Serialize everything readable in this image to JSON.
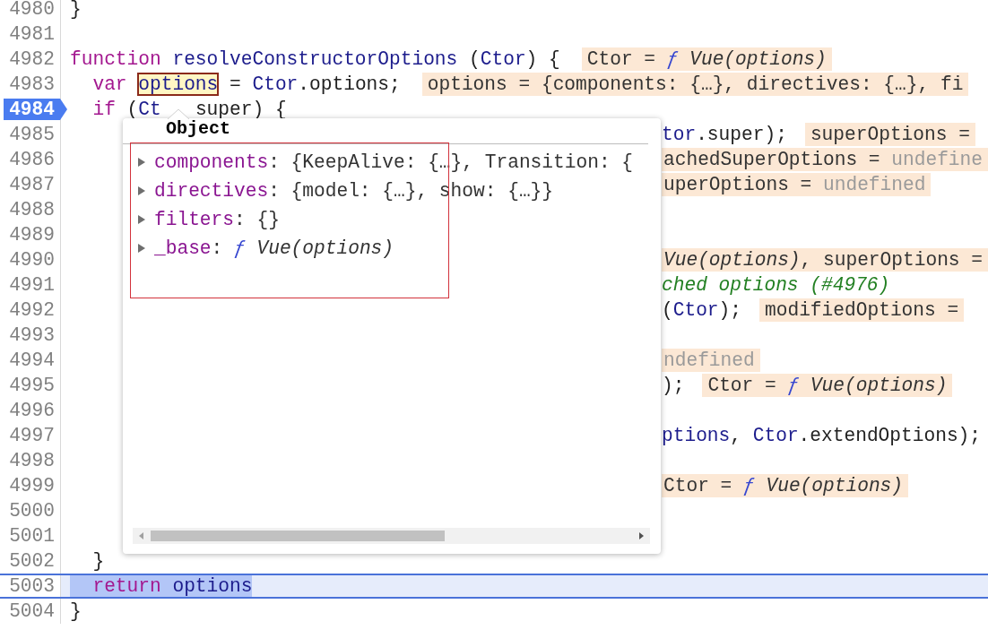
{
  "editor": {
    "lines": [
      {
        "number": "4980",
        "breakpoint": false,
        "current": false,
        "code": [
          {
            "t": "}",
            "kind": "plain"
          }
        ]
      },
      {
        "number": "4981",
        "breakpoint": false,
        "current": false
      },
      {
        "number": "4982",
        "breakpoint": false,
        "current": false,
        "code": [
          {
            "t": "function",
            "kind": "kw"
          },
          {
            "t": " resolveConstructorOptions",
            "kind": "def"
          },
          {
            "t": " (",
            "kind": "plain"
          },
          {
            "t": "Ctor",
            "kind": "def"
          },
          {
            "t": ") {",
            "kind": "plain"
          }
        ],
        "value": [
          {
            "t": "Ctor =",
            "kind": "text"
          },
          {
            "t": " ƒ",
            "kind": "fn"
          },
          {
            "t": " Vue(options)",
            "kind": "ital"
          }
        ]
      },
      {
        "number": "4983",
        "breakpoint": false,
        "current": false,
        "code": [
          {
            "t": "  var ",
            "kind": "kw"
          },
          {
            "t": "options",
            "kind": "hover"
          },
          {
            "t": " = ",
            "kind": "plain"
          },
          {
            "t": "Ctor",
            "kind": "def"
          },
          {
            "t": ".options;",
            "kind": "plain"
          }
        ],
        "value": [
          {
            "t": "options = {components: {…}, directives: {…}, fi",
            "kind": "text"
          }
        ]
      },
      {
        "number": "4984",
        "breakpoint": true,
        "current": false,
        "code": [
          {
            "t": "  if",
            "kind": "kw"
          },
          {
            "t": " (",
            "kind": "plain"
          },
          {
            "t": "Ct",
            "kind": "def"
          }
        ],
        "code_rest": [
          {
            "t": "super) {",
            "kind": "plain"
          }
        ]
      },
      {
        "number": "4985",
        "breakpoint": false,
        "current": false,
        "tail": {
          "code": [
            {
              "t": "tor",
              "kind": "def"
            },
            {
              "t": ".super);",
              "kind": "plain"
            }
          ],
          "value": [
            {
              "t": "superOptions =",
              "kind": "text"
            }
          ]
        }
      },
      {
        "number": "4986",
        "breakpoint": false,
        "current": false,
        "tail": {
          "value": [
            {
              "t": "achedSuperOptions =",
              "kind": "text"
            },
            {
              "t": " undefine",
              "kind": "undef"
            }
          ]
        }
      },
      {
        "number": "4987",
        "breakpoint": false,
        "current": false,
        "tail": {
          "value": [
            {
              "t": "uperOptions =",
              "kind": "text"
            },
            {
              "t": " undefined",
              "kind": "undef"
            }
          ]
        }
      },
      {
        "number": "4988",
        "breakpoint": false,
        "current": false
      },
      {
        "number": "4989",
        "breakpoint": false,
        "current": false
      },
      {
        "number": "4990",
        "breakpoint": false,
        "current": false,
        "tail": {
          "value": [
            {
              "t": "Vue(options)",
              "kind": "ital"
            },
            {
              "t": ", superOptions =",
              "kind": "text"
            }
          ]
        }
      },
      {
        "number": "4991",
        "breakpoint": false,
        "current": false,
        "tail": {
          "code": [
            {
              "t": "ched options (#4976)",
              "kind": "comment"
            }
          ]
        }
      },
      {
        "number": "4992",
        "breakpoint": false,
        "current": false,
        "tail": {
          "code": [
            {
              "t": "(",
              "kind": "plain"
            },
            {
              "t": "Ctor",
              "kind": "def"
            },
            {
              "t": ");",
              "kind": "plain"
            }
          ],
          "value": [
            {
              "t": "modifiedOptions =",
              "kind": "text"
            }
          ]
        }
      },
      {
        "number": "4993",
        "breakpoint": false,
        "current": false
      },
      {
        "number": "4994",
        "breakpoint": false,
        "current": false,
        "tail": {
          "value": [
            {
              "t": "ndefined",
              "kind": "undef"
            }
          ]
        }
      },
      {
        "number": "4995",
        "breakpoint": false,
        "current": false,
        "tail": {
          "code": [
            {
              "t": ");",
              "kind": "plain"
            }
          ],
          "value": [
            {
              "t": "Ctor =",
              "kind": "text"
            },
            {
              "t": " ƒ",
              "kind": "fn"
            },
            {
              "t": " Vue(options)",
              "kind": "ital"
            }
          ]
        }
      },
      {
        "number": "4996",
        "breakpoint": false,
        "current": false
      },
      {
        "number": "4997",
        "breakpoint": false,
        "current": false,
        "tail": {
          "code": [
            {
              "t": "ptions",
              "kind": "def"
            },
            {
              "t": ", ",
              "kind": "plain"
            },
            {
              "t": "Ctor",
              "kind": "def"
            },
            {
              "t": ".extendOptions);",
              "kind": "plain"
            }
          ]
        }
      },
      {
        "number": "4998",
        "breakpoint": false,
        "current": false
      },
      {
        "number": "4999",
        "breakpoint": false,
        "current": false,
        "tail": {
          "value": [
            {
              "t": "Ctor =",
              "kind": "text"
            },
            {
              "t": " ƒ",
              "kind": "fn"
            },
            {
              "t": " Vue(options)",
              "kind": "ital"
            }
          ]
        }
      },
      {
        "number": "5000",
        "breakpoint": false,
        "current": false
      },
      {
        "number": "5001",
        "breakpoint": false,
        "current": false
      },
      {
        "number": "5002",
        "breakpoint": false,
        "current": false,
        "code": [
          {
            "t": "  }",
            "kind": "plain"
          }
        ]
      },
      {
        "number": "5003",
        "breakpoint": false,
        "current": true,
        "code": [
          {
            "t": "  return",
            "kind": "kw"
          },
          {
            "t": " options",
            "kind": "def"
          }
        ]
      },
      {
        "number": "5004",
        "breakpoint": false,
        "current": false,
        "code": [
          {
            "t": "}",
            "kind": "plain"
          }
        ]
      }
    ]
  },
  "popover": {
    "title": "Object",
    "properties": [
      {
        "key": "components",
        "expanded": false,
        "value": [
          {
            "t": ": {KeepAlive: {…}, Transition: {",
            "kind": "text"
          }
        ]
      },
      {
        "key": "directives",
        "expanded": false,
        "value": [
          {
            "t": ": {model: {…}, show: {…}}",
            "kind": "text"
          }
        ]
      },
      {
        "key": "filters",
        "expanded": false,
        "value": [
          {
            "t": ": {}",
            "kind": "text"
          }
        ]
      },
      {
        "key": "_base",
        "expanded": false,
        "value": [
          {
            "t": ":",
            "kind": "text"
          },
          {
            "t": " ƒ",
            "kind": "fn"
          },
          {
            "t": " Vue(options)",
            "kind": "ital"
          }
        ]
      }
    ]
  }
}
